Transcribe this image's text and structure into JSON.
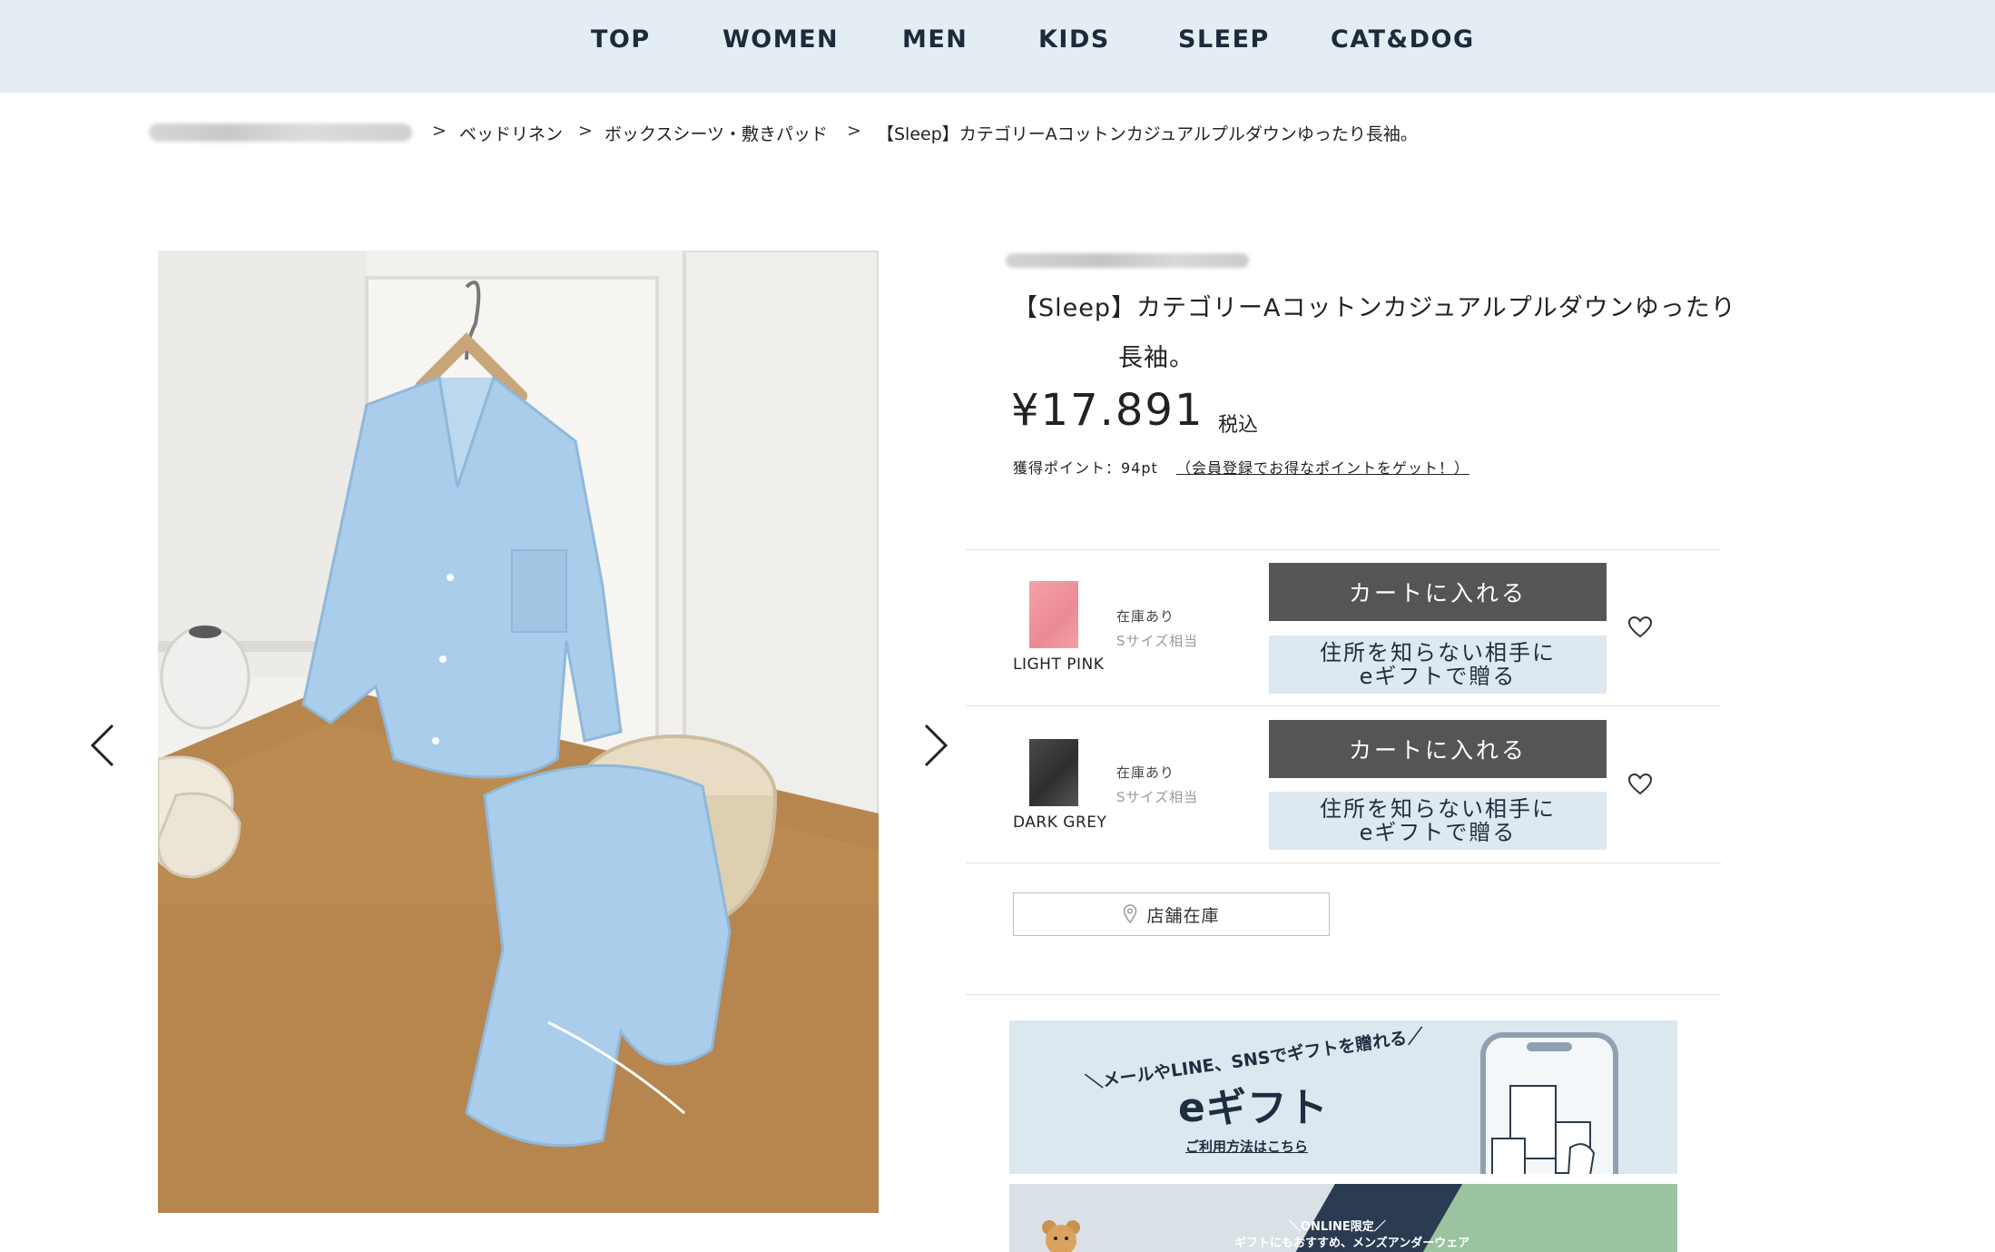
{
  "nav": [
    "TOP",
    "WOMEN",
    "MEN",
    "KIDS",
    "SLEEP",
    "CAT&DOG"
  ],
  "breadcrumb": {
    "sep": ">",
    "items": [
      "ベッドリネン",
      "ボックスシーツ・敷きパッド",
      "【Sleep】カテゴリーAコットンカジュアルプルダウンゆったり長袖。"
    ]
  },
  "product": {
    "title_line1": "【Sleep】カテゴリーAコットンカジュアルプルダウンゆったり",
    "title_line2": "長袖。",
    "price": "¥17.891",
    "tax_label": "税込",
    "points_label": "獲得ポイント：94pt",
    "points_link": "（会員登録でお得なポイントをゲット！）"
  },
  "variants": [
    {
      "color_name": "LIGHT PINK",
      "stock": "在庫あり",
      "size": "Sサイズ相当",
      "cart_label": "カートに入れる",
      "gift_line1": "住所を知らない相手に",
      "gift_line2": "eギフトで贈る",
      "swatch_color": "#ee8e96"
    },
    {
      "color_name": "DARK GREY",
      "stock": "在庫あり",
      "size": "Sサイズ相当",
      "cart_label": "カートに入れる",
      "gift_line1": "住所を知らない相手に",
      "gift_line2": "eギフトで贈る",
      "swatch_color": "#3a3a3a"
    }
  ],
  "store_stock_label": "店舗在庫",
  "banner_egift": {
    "tagline": "＼メールやLINE、SNSでギフトを贈れる／",
    "title": "eギフト",
    "link": "ご利用方法はこちら"
  },
  "banner_underwear": {
    "line1": "＼ONLINE限定／",
    "line2": "ギフトにもおすすめ、メンズアンダーウェア"
  },
  "colors": {
    "nav_bg": "#e4edf4",
    "cart_btn": "#555555",
    "gift_btn_bg": "#dde8f1",
    "pajama_blue": "#a9cdea"
  }
}
